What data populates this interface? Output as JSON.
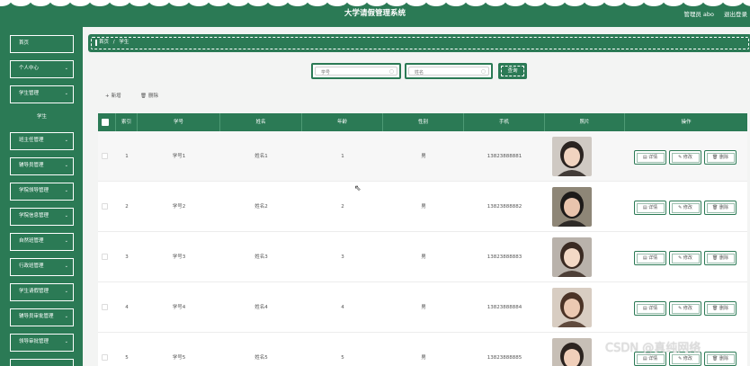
{
  "header": {
    "title": "大学请假管理系统",
    "user": "管理员 abo",
    "logout": "退出登录",
    "accent": "#2b7a55"
  },
  "sidebar": {
    "items": [
      {
        "label": "首页",
        "has_chevron": false
      },
      {
        "label": "个人中心",
        "has_chevron": true
      },
      {
        "label": "学生管理",
        "has_chevron": true
      },
      {
        "label": "学生",
        "sub": true
      },
      {
        "label": "班主任管理",
        "has_chevron": true
      },
      {
        "label": "辅导员管理",
        "has_chevron": true
      },
      {
        "label": "学院领导管理",
        "has_chevron": true
      },
      {
        "label": "学院信息管理",
        "has_chevron": true
      },
      {
        "label": "自然班管理",
        "has_chevron": true
      },
      {
        "label": "行政班管理",
        "has_chevron": true
      },
      {
        "label": "学生请假管理",
        "has_chevron": true
      },
      {
        "label": "辅导员审批管理",
        "has_chevron": true
      },
      {
        "label": "领导审批管理",
        "has_chevron": true
      }
    ]
  },
  "breadcrumb": {
    "home": "首页",
    "sep": "/",
    "current": "学生"
  },
  "search": {
    "field1_placeholder": "学号",
    "field2_placeholder": "姓名",
    "button": "查询"
  },
  "toolbar": {
    "add": "新增",
    "delete": "删除",
    "add_icon": "plus-icon",
    "delete_icon": "trash-icon"
  },
  "table": {
    "columns": [
      "索引",
      "学号",
      "姓名",
      "年龄",
      "性别",
      "手机",
      "照片",
      "操作"
    ],
    "actions": {
      "detail": "详情",
      "edit": "修改",
      "delete": "删除"
    },
    "rows": [
      {
        "index": "1",
        "id": "学号1",
        "name": "姓名1",
        "age": "1",
        "gender": "男",
        "phone": "13823888881"
      },
      {
        "index": "2",
        "id": "学号2",
        "name": "姓名2",
        "age": "2",
        "gender": "男",
        "phone": "13823888882"
      },
      {
        "index": "3",
        "id": "学号3",
        "name": "姓名3",
        "age": "3",
        "gender": "男",
        "phone": "13823888883"
      },
      {
        "index": "4",
        "id": "学号4",
        "name": "姓名4",
        "age": "4",
        "gender": "男",
        "phone": "13823888884"
      },
      {
        "index": "5",
        "id": "学号5",
        "name": "姓名5",
        "age": "5",
        "gender": "男",
        "phone": "13823888885"
      }
    ]
  },
  "watermark": "CSDN @真纯网络"
}
